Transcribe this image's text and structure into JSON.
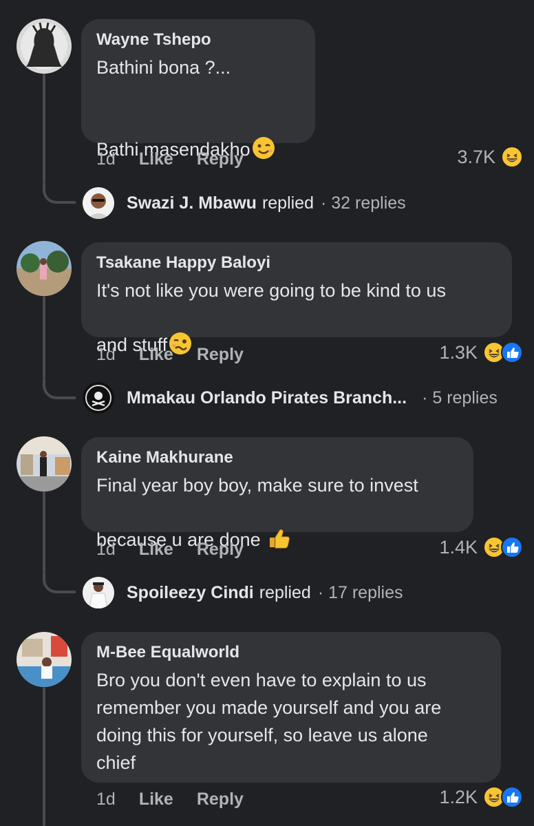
{
  "comments": [
    {
      "author": "Wayne Tshepo",
      "text": "Bathini bona ?...\n\nBathi masendakho",
      "emoji": "wink-emoji",
      "time": "1d",
      "like_label": "Like",
      "reply_label": "Reply",
      "reaction_count": "3.7K",
      "reactions": [
        "laugh-emoji"
      ],
      "reply": {
        "author": "Swazi J. Mbawu",
        "verb": "replied",
        "count": "· 32 replies"
      }
    },
    {
      "author": "Tsakane Happy Baloyi",
      "text": "It's not like you were going to be kind to us\nand stuff",
      "emoji": "woozy-emoji",
      "time": "1d",
      "like_label": "Like",
      "reply_label": "Reply",
      "reaction_count": "1.3K",
      "reactions": [
        "laugh-emoji",
        "like-emoji"
      ],
      "reply": {
        "author": "Mmakau Orlando Pirates  Branch...",
        "verb": "",
        "count": "· 5 replies"
      }
    },
    {
      "author": "Kaine Makhurane",
      "text": "Final year boy boy, make sure to invest\nbecause u are done",
      "emoji": "thumbs-up-emoji",
      "time": "1d",
      "like_label": "Like",
      "reply_label": "Reply",
      "reaction_count": "1.4K",
      "reactions": [
        "laugh-emoji",
        "like-emoji"
      ],
      "reply": {
        "author": "Spoileezy Cindi",
        "verb": "replied",
        "count": "· 17 replies"
      }
    },
    {
      "author": "M-Bee Equalworld",
      "text": "Bro you don't even have to explain to us\nremember you made yourself and you are\ndoing this for yourself, so leave us alone\nchief",
      "emoji": "",
      "time": "1d",
      "like_label": "Like",
      "reply_label": "Reply",
      "reaction_count": "1.2K",
      "reactions": [
        "laugh-emoji",
        "like-emoji"
      ]
    }
  ],
  "colors": {
    "background": "#202124",
    "bubble": "#333437",
    "text": "#e4e6eb",
    "muted": "#b0b3b8",
    "like_blue": "#1877f2",
    "emoji_yellow": "#f7c531"
  }
}
